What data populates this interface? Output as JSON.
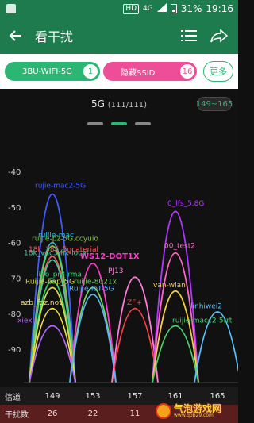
{
  "status_bar": {
    "hd": "HD",
    "network": "4G",
    "battery": "31%",
    "time": "19:16"
  },
  "app_bar": {
    "title": "看干扰"
  },
  "filters": {
    "wifi_chip": {
      "label": "3BU-WIFI-5G",
      "count": "1"
    },
    "ssid_chip": {
      "label": "隐藏SSID",
      "count": "16"
    },
    "more_label": "更多"
  },
  "band": {
    "label": "5G",
    "count": "(111/111)",
    "range": "149~165",
    "page_index": 1,
    "page_count": 3
  },
  "footer": {
    "channel_label": "信道",
    "interference_label": "干扰数",
    "channels": [
      "149",
      "153",
      "157",
      "161",
      "165"
    ],
    "interference": [
      "26",
      "22",
      "11",
      "",
      ""
    ]
  },
  "watermark": {
    "text": "气泡游戏网",
    "sub": "www.qpb29.com"
  },
  "chart_data": {
    "type": "line",
    "y_axis_label": "",
    "y_ticks": [
      -40,
      -50,
      -60,
      -70,
      -80,
      -90
    ],
    "ylim": [
      -100,
      -35
    ],
    "x_channels": [
      149,
      153,
      157,
      161,
      165
    ],
    "grid": false,
    "networks": [
      {
        "ssid": "rujie-mac2-5G",
        "channel": 149,
        "rssi": -45,
        "color": "#3f5bff"
      },
      {
        "ssid": "ruijie-mac",
        "channel": 149,
        "rssi": -59,
        "color": "#27c0e0"
      },
      {
        "ssid": "ruijie-pz-5G.ccyuio",
        "channel": 149,
        "rssi": -60,
        "color": "#7cc83f"
      },
      {
        "ssid": "18k_385_5gcaterial",
        "channel": 149,
        "rssi": -63,
        "color": "#f25c5c"
      },
      {
        "ssid": "18k_vac3-fix-local",
        "channel": 149,
        "rssi": -64,
        "color": "#46c8a0"
      },
      {
        "ssid": "libo_pr8-rma",
        "channel": 149,
        "rssi": -70,
        "color": "#29d06a"
      },
      {
        "ssid": "Ruijie-bap_5G",
        "channel": 149,
        "rssi": -72,
        "color": "#d8d84a"
      },
      {
        "ssid": "azb_fgz.nov",
        "channel": 149,
        "rssi": -78,
        "color": "#f2e13c"
      },
      {
        "ssid": "xiexi",
        "channel": 149,
        "rssi": -83,
        "color": "#b368ff"
      },
      {
        "ssid": "WS12-DOT1X",
        "channel": 153,
        "rssi": -65,
        "color": "#ff3bcb"
      },
      {
        "ssid": "ruijie-8021x",
        "channel": 153,
        "rssi": -72,
        "color": "#6fd85a"
      },
      {
        "ssid": "Ruijie-IoT-5G",
        "channel": 153,
        "rssi": -74,
        "color": "#58b7ff"
      },
      {
        "ssid": "ZF+",
        "channel": 157,
        "rssi": -78,
        "color": "#ff4040"
      },
      {
        "ssid": "PJ13",
        "channel": 157,
        "rssi": -69,
        "color": "#ff7ad9"
      },
      {
        "ssid": "0_lfs_5.8G",
        "channel": 161,
        "rssi": -50,
        "color": "#b338ff"
      },
      {
        "ssid": "00_test2",
        "channel": 161,
        "rssi": -62,
        "color": "#ff66c4"
      },
      {
        "ssid": "van-wlan",
        "channel": 161,
        "rssi": -73,
        "color": "#f2d23c"
      },
      {
        "ssid": "ruijie-macc2-5rrt",
        "channel": 161,
        "rssi": -83,
        "color": "#49d06a"
      },
      {
        "ssid": "linhiwei2",
        "channel": 165,
        "rssi": -79,
        "color": "#56c1ff"
      }
    ]
  }
}
